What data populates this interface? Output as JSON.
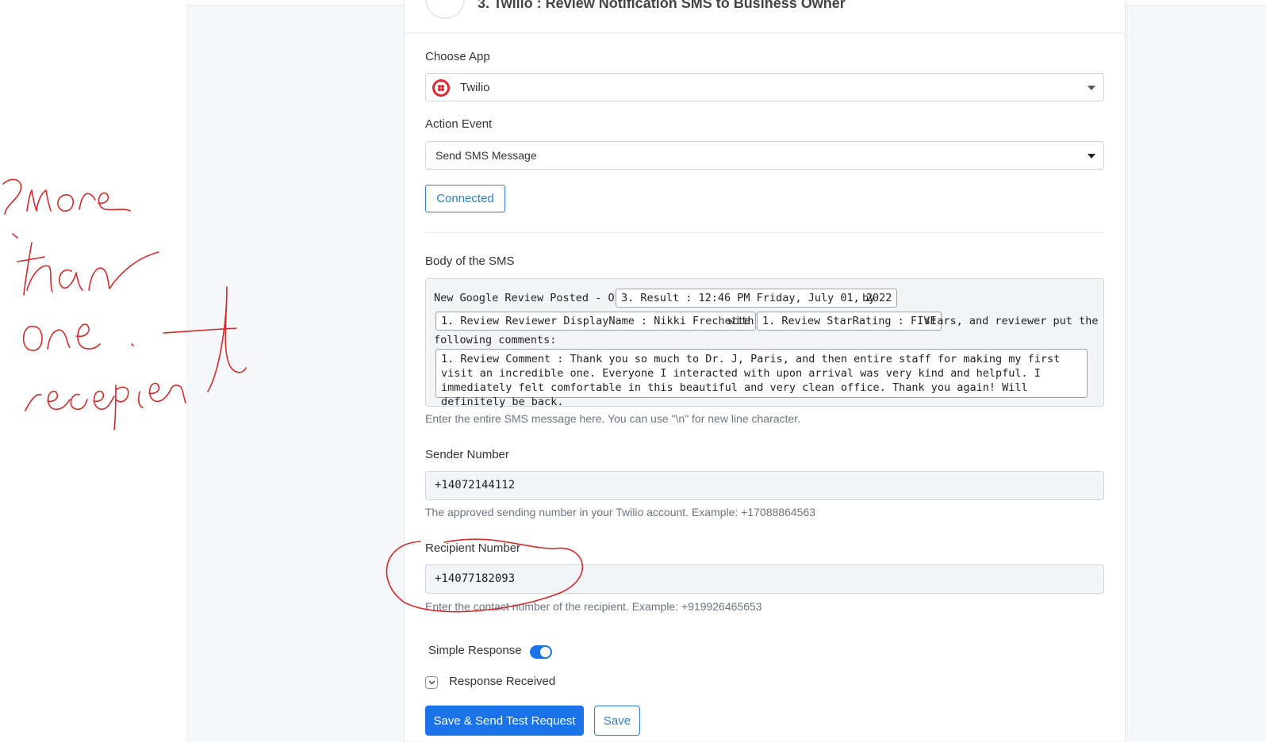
{
  "header": {
    "title": "3. Twilio : Review Notification SMS to Business Owner"
  },
  "choose_app": {
    "label": "Choose App",
    "value": "Twilio",
    "icon": "twilio-logo-icon"
  },
  "action_event": {
    "label": "Action Event",
    "value": "Send SMS Message"
  },
  "connected_label": "Connected",
  "body": {
    "label": "Body of the SMS",
    "line1_prefix": "New Google Review Posted - On",
    "chip_result": "3. Result : 12:46 PM Friday, July 01, 2022",
    "line1_suffix": "by",
    "chip_reviewer": "1. Review Reviewer DisplayName : Nikki Frechette",
    "with_text": "with",
    "chip_rating": "1. Review StarRating : FIVE",
    "stars_text": "stars, and reviewer put the",
    "line3": "following comments:",
    "chip_comment": "1. Review Comment : Thank you so much to Dr. J, Paris, and then entire staff for making my first visit an incredible one. Everyone I interacted with upon arrival was very kind and helpful. I immediately felt comfortable in this beautiful and very clean office. Thank you again! Will definitely be back.",
    "help": "Enter the entire SMS message here. You can use \"\\n\" for new line character."
  },
  "sender": {
    "label": "Sender Number",
    "value": "+14072144112",
    "help": "The approved sending number in your Twilio account. Example: +17088864563"
  },
  "recipient": {
    "label": "Recipient Number",
    "value": "+14077182093",
    "help": "Enter the contact number of the recipient. Example: +919926465653"
  },
  "simple_response": {
    "label": "Simple Response",
    "enabled": true
  },
  "response_received": {
    "label": "Response Received"
  },
  "buttons": {
    "save_test": "Save & Send Test Request",
    "save": "Save"
  },
  "colors": {
    "accent": "#1a73e8",
    "twilio_red": "#e0262c",
    "annotation_red": "#d42a2a"
  }
}
